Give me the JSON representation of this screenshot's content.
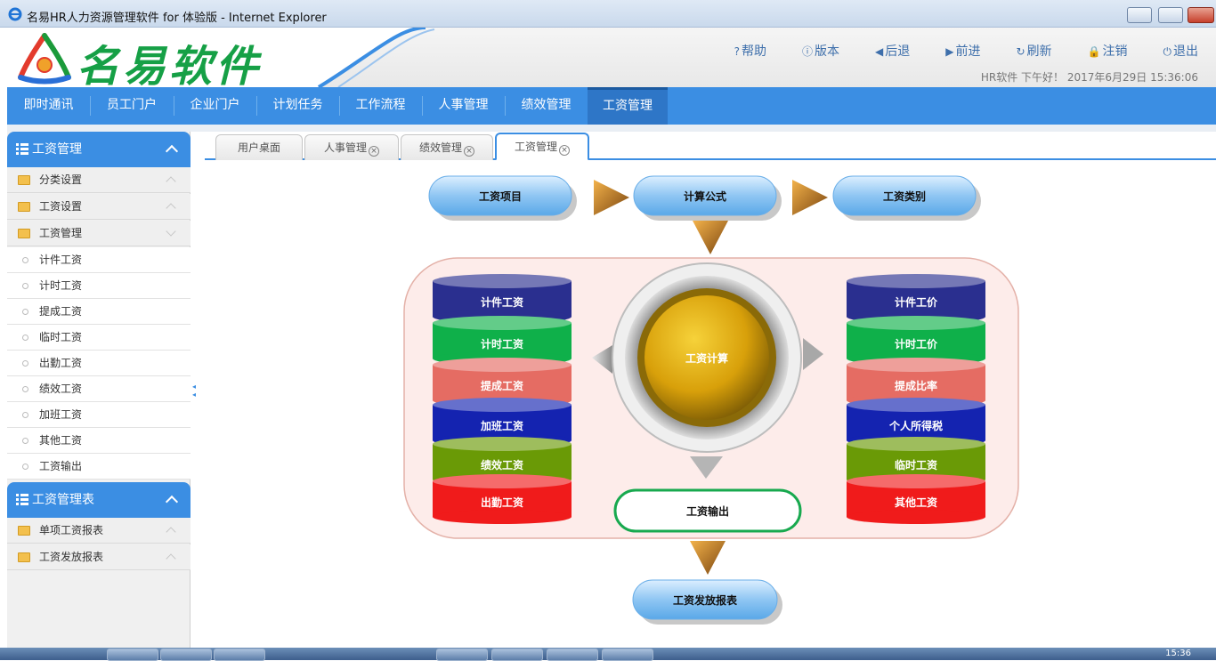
{
  "window": {
    "title": "名易HR人力资源管理软件 for 体验版 - Internet Explorer"
  },
  "header": {
    "logo_text": "名易软件",
    "links": [
      {
        "icon": "help-icon",
        "label": "帮助"
      },
      {
        "icon": "info-icon",
        "label": "版本"
      },
      {
        "icon": "back-arrow-icon",
        "label": "后退"
      },
      {
        "icon": "forward-arrow-icon",
        "label": "前进"
      },
      {
        "icon": "refresh-icon",
        "label": "刷新"
      },
      {
        "icon": "lock-icon",
        "label": "注销"
      },
      {
        "icon": "power-icon",
        "label": "退出"
      }
    ],
    "greeting": "HR软件 下午好！ 2017年6月29日 15:36:06"
  },
  "nav": {
    "items": [
      "即时通讯",
      "员工门户",
      "企业门户",
      "计划任务",
      "工作流程",
      "人事管理",
      "绩效管理",
      "工资管理"
    ],
    "active": "工资管理"
  },
  "sidebar": {
    "section1": {
      "title": "工资管理",
      "folders": [
        "分类设置",
        "工资设置",
        "工资管理"
      ],
      "subitems": [
        "计件工资",
        "计时工资",
        "提成工资",
        "临时工资",
        "出勤工资",
        "绩效工资",
        "加班工资",
        "其他工资",
        "工资输出"
      ]
    },
    "section2": {
      "title": "工资管理表",
      "folders": [
        "单项工资报表",
        "工资发放报表"
      ]
    }
  },
  "tabs": [
    "用户桌面",
    "人事管理",
    "绩效管理",
    "工资管理"
  ],
  "active_tab": "工资管理",
  "diagram": {
    "top": [
      "工资项目",
      "计算公式",
      "工资类别"
    ],
    "center": "工资计算",
    "left_stack": [
      "计件工资",
      "计时工资",
      "提成工资",
      "加班工资",
      "绩效工资",
      "出勤工资"
    ],
    "right_stack": [
      "计件工价",
      "计时工价",
      "提成比率",
      "个人所得税",
      "临时工资",
      "其他工资"
    ],
    "output": "工资输出",
    "report": "工资发放报表"
  },
  "colors": {
    "nav_blue": "#3b8ee3",
    "stack": [
      "#2a2f8f",
      "#0fb04a",
      "#e56c63",
      "#1423b0",
      "#6a9a06",
      "#f01b1b"
    ]
  },
  "taskbar": {
    "clock": "15:36"
  }
}
